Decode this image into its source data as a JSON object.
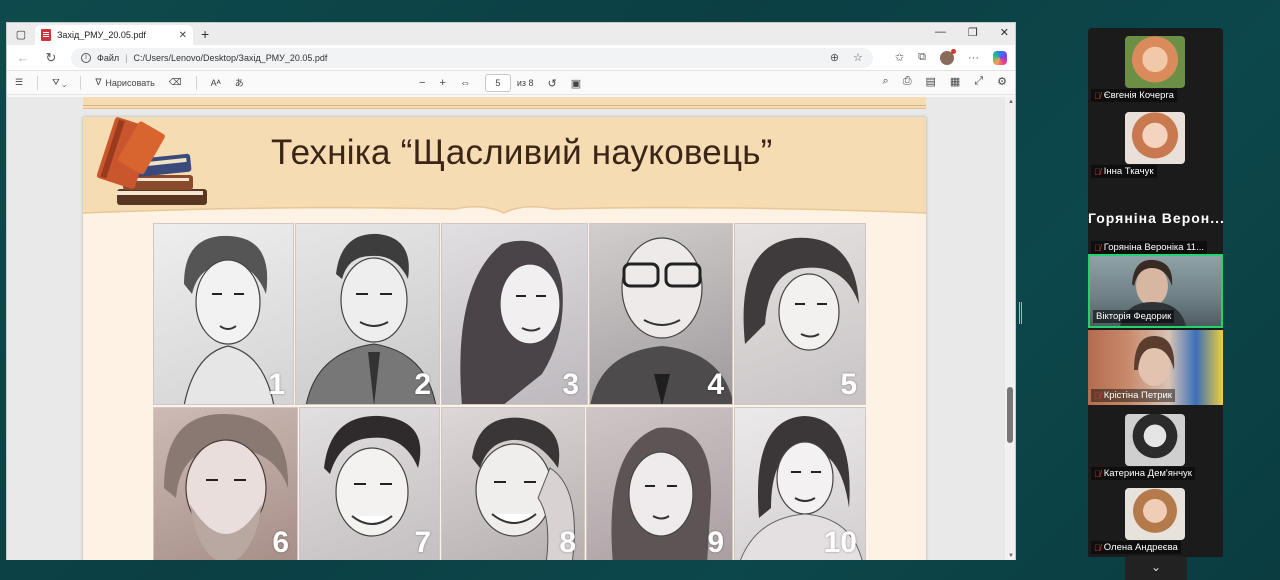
{
  "browser": {
    "tab_title": "Захід_РМУ_20.05.pdf",
    "url_scheme": "Файл",
    "url_path": "C:/Users/Lenovo/Desktop/Захід_РМУ_20.05.pdf"
  },
  "pdf_toolbar": {
    "draw_label": "Нарисовать",
    "page_number": "5",
    "page_total": "из 8"
  },
  "slide": {
    "title": "Техніка “Щасливий науковець”",
    "portrait_numbers": [
      "1",
      "2",
      "3",
      "4",
      "5",
      "6",
      "7",
      "8",
      "9",
      "10"
    ]
  },
  "participants": [
    {
      "name": "Євгенія Кочерга",
      "muted": true
    },
    {
      "name": "Інна Ткачук",
      "muted": true
    },
    {
      "name": "Горяніна Вероніка 11...",
      "display_text": "Горяніна Верон...",
      "muted": true
    },
    {
      "name": "Вікторія Федорик",
      "muted": false,
      "active": true
    },
    {
      "name": "Крістіна Петрик",
      "muted": true
    },
    {
      "name": "Катерина Дем'янчук",
      "muted": true
    },
    {
      "name": "Олена Андреєва",
      "muted": true
    }
  ],
  "colors": {
    "page_bg": "#fdf2e3",
    "header_band": "#f6dcb3",
    "title_text": "#3b2516",
    "active_speaker": "#23d36b",
    "muted_icon": "#e5383b"
  }
}
